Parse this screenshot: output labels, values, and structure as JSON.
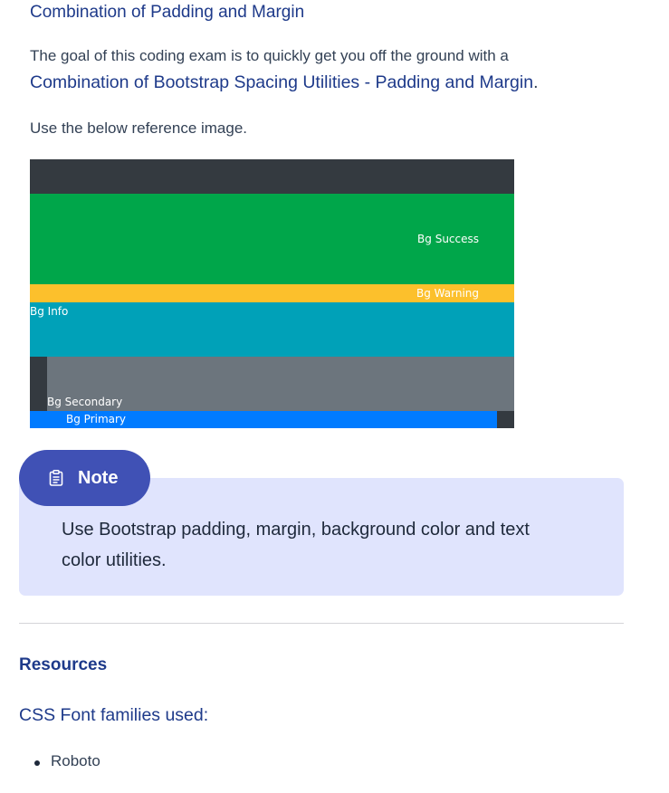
{
  "heading": "Combination of Padding and Margin",
  "intro": {
    "text": "The goal of this coding exam is to quickly get you off the ground with a",
    "link": "Combination of Bootstrap Spacing Utilities - Padding and Margin",
    "end": "."
  },
  "reference_text": "Use the below reference image.",
  "reference_image": {
    "bg_success": "Bg Success",
    "bg_warning": "Bg Warning",
    "bg_info": "Bg Info",
    "bg_secondary": "Bg Secondary",
    "bg_primary": "Bg Primary",
    "colors": {
      "dark": "#343a40",
      "success": "#00a64a",
      "warning": "#fcc02c",
      "info": "#00a1b8",
      "secondary": "#6c757d",
      "primary": "#007bff"
    }
  },
  "note": {
    "icon": "clipboard-icon",
    "label": "Note",
    "line1": "Use Bootstrap padding, margin, background color and text",
    "line2": "color utilities."
  },
  "resources": {
    "heading": "Resources",
    "fonts_heading": "CSS Font families used:",
    "fonts": [
      "Roboto"
    ]
  }
}
